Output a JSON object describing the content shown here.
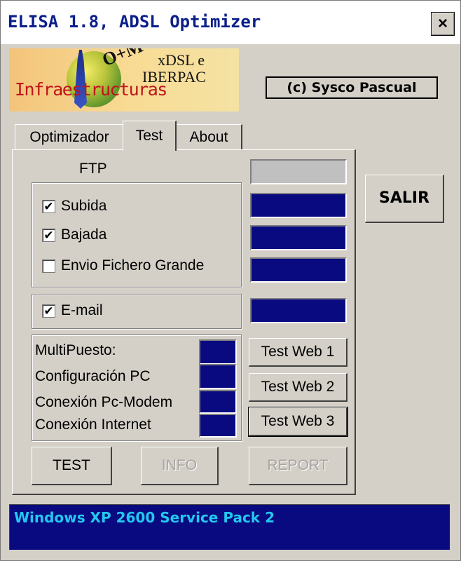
{
  "window": {
    "title": "ELISA 1.8,  ADSL Optimizer",
    "close_label": "×"
  },
  "logo": {
    "om": "O+M",
    "xdsl": "xDSL e",
    "iberpac": "IBERPAC",
    "infra": "Infraestructuras"
  },
  "copyright": "(c) Sysco Pascual",
  "tabs": [
    {
      "label": "Optimizador",
      "active": false
    },
    {
      "label": "Test",
      "active": true
    },
    {
      "label": "About",
      "active": false
    }
  ],
  "ftp": {
    "label": "FTP",
    "checks": [
      {
        "label": "Subida",
        "checked": true
      },
      {
        "label": "Bajada",
        "checked": true
      },
      {
        "label": "Envio Fichero Grande",
        "checked": false
      }
    ]
  },
  "email": {
    "label": "E-mail",
    "checked": true
  },
  "diagnostics": [
    "MultiPuesto:",
    "Configuración PC",
    "Conexión Pc-Modem",
    "Conexión Internet"
  ],
  "test_web_buttons": [
    "Test Web 1",
    "Test Web 2",
    "Test Web 3"
  ],
  "buttons": {
    "test": "TEST",
    "info": "INFO",
    "report": "REPORT",
    "salir": "SALIR"
  },
  "check_mark": "✔",
  "status": "Windows XP 2600 Service Pack 2",
  "colors": {
    "bar_fill": "#0a0a80",
    "status_text": "#22c8f0",
    "title_text": "#0a1f8a"
  }
}
